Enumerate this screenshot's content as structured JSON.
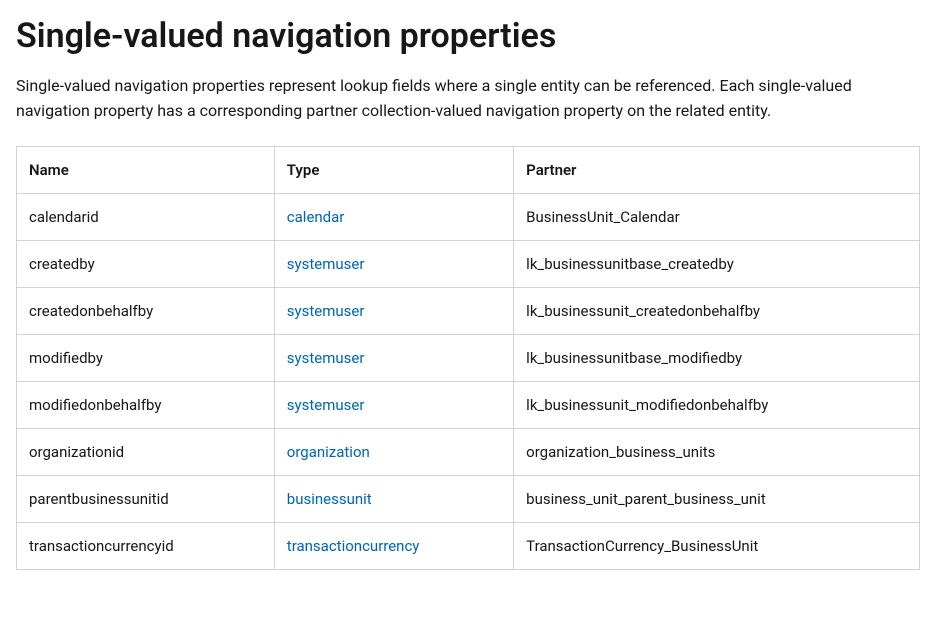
{
  "heading": "Single-valued navigation properties",
  "description": "Single-valued navigation properties represent lookup fields where a single entity can be referenced. Each single-valued navigation property has a corresponding partner collection-valued navigation property on the related entity.",
  "table": {
    "headers": {
      "name": "Name",
      "type": "Type",
      "partner": "Partner"
    },
    "rows": [
      {
        "name": "calendarid",
        "type": "calendar",
        "partner": "BusinessUnit_Calendar"
      },
      {
        "name": "createdby",
        "type": "systemuser",
        "partner": "lk_businessunitbase_createdby"
      },
      {
        "name": "createdonbehalfby",
        "type": "systemuser",
        "partner": "lk_businessunit_createdonbehalfby"
      },
      {
        "name": "modifiedby",
        "type": "systemuser",
        "partner": "lk_businessunitbase_modifiedby"
      },
      {
        "name": "modifiedonbehalfby",
        "type": "systemuser",
        "partner": "lk_businessunit_modifiedonbehalfby"
      },
      {
        "name": "organizationid",
        "type": "organization",
        "partner": "organization_business_units"
      },
      {
        "name": "parentbusinessunitid",
        "type": "businessunit",
        "partner": "business_unit_parent_business_unit"
      },
      {
        "name": "transactioncurrencyid",
        "type": "transactioncurrency",
        "partner": "TransactionCurrency_BusinessUnit"
      }
    ]
  }
}
